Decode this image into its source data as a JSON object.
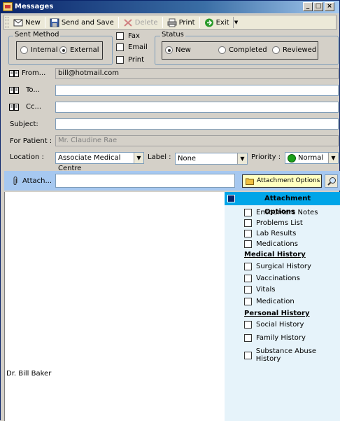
{
  "window": {
    "title": "Messages"
  },
  "toolbar": {
    "new_label": "New",
    "send_save_label": "Send and Save",
    "delete_label": "Delete",
    "print_label": "Print",
    "exit_label": "Exit"
  },
  "sent_method": {
    "legend": "Sent Method",
    "options": [
      {
        "label": "Internal",
        "selected": false
      },
      {
        "label": "External",
        "selected": true
      }
    ]
  },
  "channels": [
    {
      "label": "Fax",
      "checked": false
    },
    {
      "label": "Email",
      "checked": false
    },
    {
      "label": "Print",
      "checked": false
    }
  ],
  "status": {
    "legend": "Status",
    "options": [
      {
        "label": "New",
        "selected": true
      },
      {
        "label": "Completed",
        "selected": false
      },
      {
        "label": "Reviewed",
        "selected": false
      }
    ]
  },
  "form": {
    "from_label": "From...",
    "from_value": "bill@hotmail.com",
    "to_label": "To...",
    "to_value": "",
    "cc_label": "Cc...",
    "cc_value": "",
    "subject_label": "Subject:",
    "subject_value": "",
    "patient_label": "For Patient :",
    "patient_value": "Mr. Claudine  Rae",
    "location_label": "Location :",
    "location_value": "Associate Medical Centre",
    "label_label": "Label :",
    "label_value": "None",
    "priority_label": "Priority :",
    "priority_value": "Normal",
    "attach_label": "Attach...",
    "attach_value": ""
  },
  "attachment_button": "Attachment Options",
  "editor": {
    "signature": "Dr. Bill Baker"
  },
  "panel": {
    "title": "Attachment Options",
    "items_top": [
      {
        "label": "Encounters Notes",
        "checked": false
      },
      {
        "label": "Problems List",
        "checked": false
      },
      {
        "label": "Lab Results",
        "checked": false
      },
      {
        "label": "Medications",
        "checked": false
      }
    ],
    "medical_history_heading": "Medical History",
    "medical_history": [
      {
        "label": "Surgical History",
        "checked": false
      },
      {
        "label": "Vaccinations",
        "checked": false
      },
      {
        "label": "Vitals",
        "checked": false
      },
      {
        "label": "Medication",
        "checked": false
      }
    ],
    "personal_history_heading": "Personal History",
    "personal_history": [
      {
        "label": "Social History",
        "checked": false
      },
      {
        "label": "Family History",
        "checked": false
      },
      {
        "label": "Substance Abuse History",
        "checked": false
      }
    ]
  },
  "colors": {
    "title_bar": "#0a246a",
    "panel_header": "#00a5e8",
    "attach_bar": "#a6c8f0",
    "priority_dot": "#1aa01a"
  }
}
